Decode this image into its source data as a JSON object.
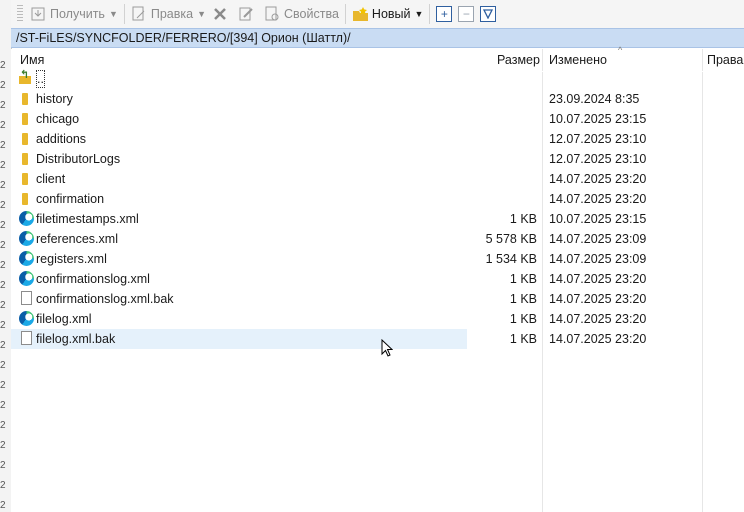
{
  "toolbar": {
    "get_label": "Получить",
    "edit_label": "Правка",
    "properties_label": "Свойства",
    "new_label": "Новый"
  },
  "path": "/ST-FiLES/SYNCFOLDER/FERRERO/[394] Орион (Шаттл)/",
  "columns": {
    "name": "Имя",
    "size": "Размер",
    "modified": "Изменено",
    "rights": "Права"
  },
  "files": [
    {
      "name": "..",
      "size": "",
      "modified": "",
      "icon": "parent-folder-icon"
    },
    {
      "name": "history",
      "size": "",
      "modified": "23.09.2024 8:35",
      "icon": "folder-icon"
    },
    {
      "name": "chicago",
      "size": "",
      "modified": "10.07.2025 23:15",
      "icon": "folder-icon"
    },
    {
      "name": "additions",
      "size": "",
      "modified": "12.07.2025 23:10",
      "icon": "folder-icon"
    },
    {
      "name": "DistributorLogs",
      "size": "",
      "modified": "12.07.2025 23:10",
      "icon": "folder-icon"
    },
    {
      "name": "client",
      "size": "",
      "modified": "14.07.2025 23:20",
      "icon": "folder-icon"
    },
    {
      "name": "confirmation",
      "size": "",
      "modified": "14.07.2025 23:20",
      "icon": "folder-icon"
    },
    {
      "name": "filetimestamps.xml",
      "size": "1 KB",
      "modified": "10.07.2025 23:15",
      "icon": "edge-icon"
    },
    {
      "name": "references.xml",
      "size": "5 578 KB",
      "modified": "14.07.2025 23:09",
      "icon": "edge-icon"
    },
    {
      "name": "registers.xml",
      "size": "1 534 KB",
      "modified": "14.07.2025 23:09",
      "icon": "edge-icon"
    },
    {
      "name": "confirmationslog.xml",
      "size": "1 KB",
      "modified": "14.07.2025 23:20",
      "icon": "edge-icon"
    },
    {
      "name": "confirmationslog.xml.bak",
      "size": "1 KB",
      "modified": "14.07.2025 23:20",
      "icon": "file-icon"
    },
    {
      "name": "filelog.xml",
      "size": "1 KB",
      "modified": "14.07.2025 23:20",
      "icon": "edge-icon"
    },
    {
      "name": "filelog.xml.bak",
      "size": "1 KB",
      "modified": "14.07.2025 23:20",
      "icon": "file-icon"
    }
  ],
  "colors": {
    "pathbar_bg": "#c9dcf3",
    "hover_row": "#e5f1fb",
    "folder": "#e8b72c"
  }
}
